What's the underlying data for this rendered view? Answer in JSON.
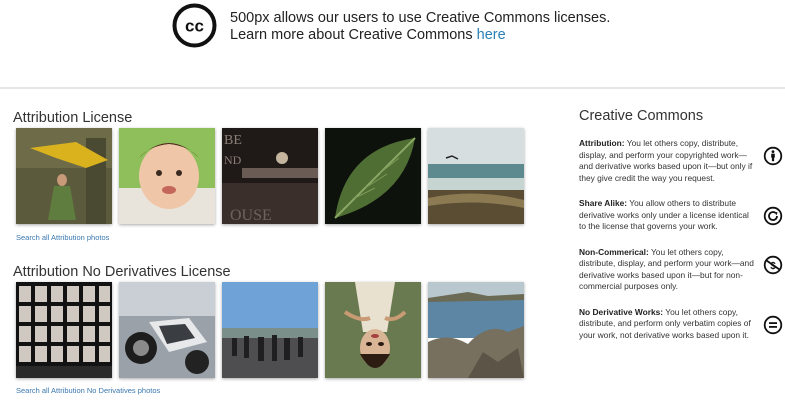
{
  "banner": {
    "line1": "500px allows our users to use Creative Commons licenses.",
    "line2": "Learn more about Creative Commons ",
    "link": "here"
  },
  "attribution": {
    "title": "Attribution License",
    "search_link": "Search all Attribution photos",
    "photos": [
      "yellow-dancer-photo",
      "baby-face-photo",
      "pier-sign-photo",
      "leaf-photo",
      "beach-photo"
    ]
  },
  "no_derivatives": {
    "title": "Attribution No Derivatives License",
    "search_link": "Search all Attribution No Derivatives photos",
    "photos": [
      "portrait-grid-photo",
      "motorcycles-photo",
      "crowd-street-photo",
      "upside-down-woman-photo",
      "coast-rocks-photo"
    ]
  },
  "sidebar": {
    "title": "Creative Commons",
    "licenses": [
      {
        "name": "Attribution:",
        "text": " You let others copy, distribute, display, and perform your copyrighted work—and derivative works based upon it—but only if they give credit the way you request.",
        "icon": "attribution-icon"
      },
      {
        "name": "Share Alike:",
        "text": " You allow others to distribute derivative works only under a license identical to the license that governs your work.",
        "icon": "share-alike-icon"
      },
      {
        "name": "Non-Commerical:",
        "text": " You let others copy, distribute, display, and perform your work—and derivative works based upon it—but for non-commercial purposes only.",
        "icon": "non-commercial-icon"
      },
      {
        "name": "No Derivative Works:",
        "text": " You let others copy, distribute, and perform only verbatim copies of your work, not derivative works based upon it.",
        "icon": "no-derivatives-icon"
      }
    ]
  }
}
